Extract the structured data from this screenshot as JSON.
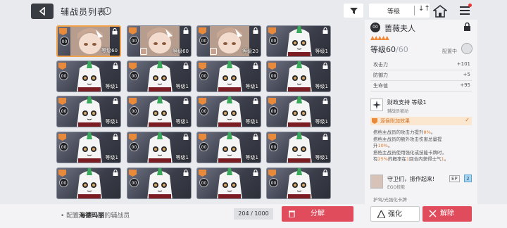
{
  "header": {
    "title": "辅战员列表",
    "info_icon": "i",
    "sort_label": "等级",
    "order_icon": "↓↑"
  },
  "cards": [
    {
      "level": "等级60",
      "selected": true,
      "variant": "a"
    },
    {
      "level": "等级60",
      "selected": false,
      "variant": "a"
    },
    {
      "level": "等级20",
      "selected": false,
      "variant": "a"
    },
    {
      "level": "等级1",
      "selected": false,
      "variant": "b"
    },
    {
      "level": "等级1",
      "selected": false,
      "variant": "b"
    },
    {
      "level": "等级1",
      "selected": false,
      "variant": "b"
    },
    {
      "level": "等级1",
      "selected": false,
      "variant": "b"
    },
    {
      "level": "等级1",
      "selected": false,
      "variant": "b"
    },
    {
      "level": "等级1",
      "selected": false,
      "variant": "b"
    },
    {
      "level": "等级1",
      "selected": false,
      "variant": "b"
    },
    {
      "level": "等级1",
      "selected": false,
      "variant": "b"
    },
    {
      "level": "等级1",
      "selected": false,
      "variant": "b"
    },
    {
      "level": "等级1",
      "selected": false,
      "variant": "b"
    },
    {
      "level": "等级1",
      "selected": false,
      "variant": "b"
    },
    {
      "level": "等级1",
      "selected": false,
      "variant": "b"
    },
    {
      "level": "等级1",
      "selected": false,
      "variant": "b"
    },
    {
      "level": "",
      "selected": false,
      "variant": "b"
    },
    {
      "level": "",
      "selected": false,
      "variant": "b"
    },
    {
      "level": "",
      "selected": false,
      "variant": "b"
    },
    {
      "level": "",
      "selected": false,
      "variant": "b"
    }
  ],
  "card_rank_label": "00",
  "detail": {
    "rank": "00",
    "name": "蔷薇夫人",
    "stars": "▲▲▲▲▲",
    "level_label": "等级60",
    "level_max": "/60",
    "assigned": "配置中",
    "stats": [
      {
        "k": "攻击力",
        "v": "+101"
      },
      {
        "k": "防御力",
        "v": "+5"
      },
      {
        "k": "生命值",
        "v": "+95"
      }
    ],
    "skill_title": "财政支持 等级1",
    "skill_sub": "辅战员被动",
    "source_label": "源侯附加效果",
    "source_check": "✓",
    "desc1_a": "搭档主战员的攻击力提升",
    "desc1_b": "8%",
    "desc1_c": "。",
    "desc2": "搭档主战员的额外攻击伤害总量提",
    "desc3_a": "升",
    "desc3_b": "10%",
    "desc3_c": "。",
    "desc4": "搭档主战员使用强化或技能卡牌时，",
    "desc5_a": "有",
    "desc5_b": "25%",
    "desc5_c": "的概率在",
    "desc5_d": "1",
    "desc5_e": "回合内获得士气",
    "desc5_f": "1",
    "desc5_g": "。",
    "ego_title": "守卫们，振作起来!",
    "ego_sub": "EGO技能",
    "ep_label": "EP",
    "ep_value": "2",
    "cut_text": "护驾/光强化卡牌"
  },
  "bottom": {
    "prefix": "• 配置",
    "name": "海德玛丽",
    "suffix": "的辅战员",
    "count": "204 / 1000",
    "dismantle": "分解",
    "enhance": "强化",
    "remove": "解除"
  },
  "colors": {
    "accent_orange": "#e88a3a",
    "button_red": "#e04c5b",
    "background": "#e9eaee"
  }
}
